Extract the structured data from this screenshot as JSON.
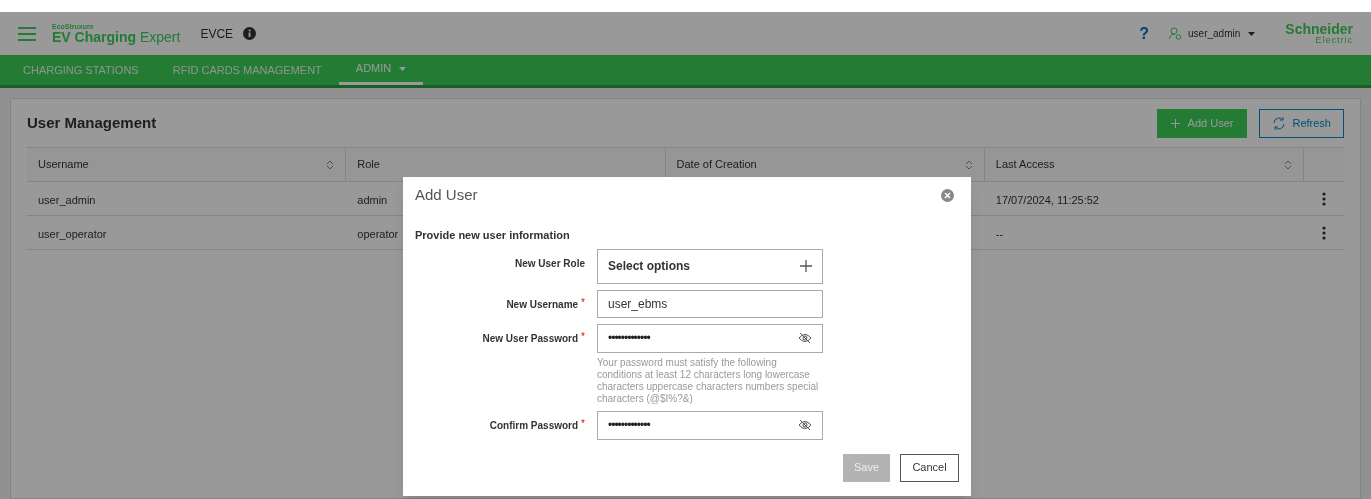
{
  "header": {
    "brand_small": "EcoStruxure",
    "brand_bold": "EV Charging",
    "brand_light": "Expert",
    "app_code": "EVCE",
    "help": "?",
    "user": "user_admin",
    "vendor_top": "Schneider",
    "vendor_bottom": "Electric"
  },
  "nav": [
    {
      "label": "CHARGING STATIONS",
      "selected": false,
      "dropdown": false
    },
    {
      "label": "RFID CARDS MANAGEMENT",
      "selected": false,
      "dropdown": false
    },
    {
      "label": "ADMIN",
      "selected": true,
      "dropdown": true
    }
  ],
  "page": {
    "title": "User Management",
    "add_button": "Add User",
    "refresh_button": "Refresh"
  },
  "table": {
    "columns": [
      {
        "label": "Username",
        "sortable": true
      },
      {
        "label": "Role",
        "sortable": false
      },
      {
        "label": "Date of Creation",
        "sortable": true
      },
      {
        "label": "Last Access",
        "sortable": true
      }
    ],
    "rows": [
      {
        "username": "user_admin",
        "role": "admin",
        "last_access": "17/07/2024, 11:25:52"
      },
      {
        "username": "user_operator",
        "role": "operator",
        "last_access": "--"
      }
    ]
  },
  "dialog": {
    "title": "Add User",
    "subtitle": "Provide new user information",
    "fields": [
      {
        "kind": "select",
        "label": "New User Role",
        "placeholder": "Select options"
      },
      {
        "kind": "text",
        "label": "New Username",
        "required_mark": "*",
        "value": "user_ebms"
      },
      {
        "kind": "password",
        "label": "New User Password",
        "required_mark": "*",
        "value": "•••••••••••••",
        "hint": "Your password must satisfy the following conditions at least 12 characters long lowercase characters uppercase characters numbers special characters (@$I%?&)"
      },
      {
        "kind": "password",
        "label": "Confirm Password",
        "required_mark": "*",
        "value": "•••••••••••••"
      }
    ],
    "save": {
      "label": "Save",
      "disabled": true
    },
    "cancel": "Cancel"
  }
}
